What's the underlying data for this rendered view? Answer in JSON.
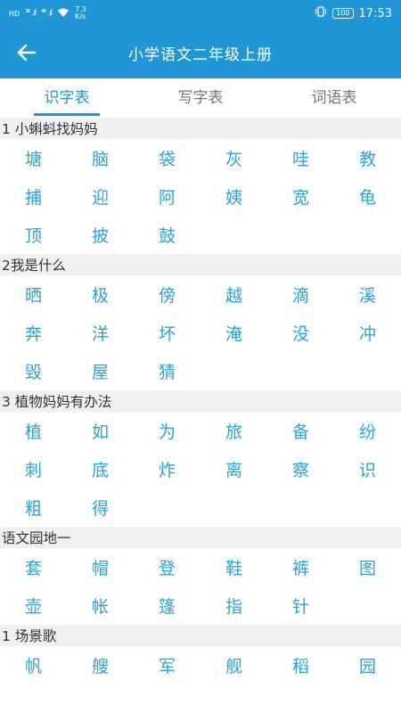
{
  "status": {
    "left_hd": "HD",
    "left_signal_1": "²⁶ .ıl",
    "left_signal_2": "⁴⁶ .ıl",
    "speed_value": "7.3",
    "speed_unit": "K/s",
    "battery": "100",
    "time": "17:53"
  },
  "appbar": {
    "title": "小学语文二年级上册"
  },
  "tabs": [
    {
      "label": "识字表"
    },
    {
      "label": "写字表"
    },
    {
      "label": "词语表"
    }
  ],
  "sections": [
    {
      "title": "1 小蝌蚪找妈妈",
      "chars": [
        "塘",
        "脑",
        "袋",
        "灰",
        "哇",
        "教",
        "捕",
        "迎",
        "阿",
        "姨",
        "宽",
        "龟",
        "顶",
        "披",
        "鼓"
      ]
    },
    {
      "title": "2我是什么",
      "chars": [
        "晒",
        "极",
        "傍",
        "越",
        "滴",
        "溪",
        "奔",
        "洋",
        "坏",
        "淹",
        "没",
        "冲",
        "毁",
        "屋",
        "猜"
      ]
    },
    {
      "title": "3 植物妈妈有办法",
      "chars": [
        "植",
        "如",
        "为",
        "旅",
        "备",
        "纷",
        "刺",
        "底",
        "炸",
        "离",
        "察",
        "识",
        "粗",
        "得"
      ]
    },
    {
      "title": "语文园地一",
      "chars": [
        "套",
        "帽",
        "登",
        "鞋",
        "裤",
        "图",
        "壶",
        "帐",
        "篷",
        "指",
        "针"
      ]
    },
    {
      "title": "1 场景歌",
      "chars": [
        "帆",
        "艘",
        "军",
        "舰",
        "稻",
        "园"
      ]
    }
  ]
}
